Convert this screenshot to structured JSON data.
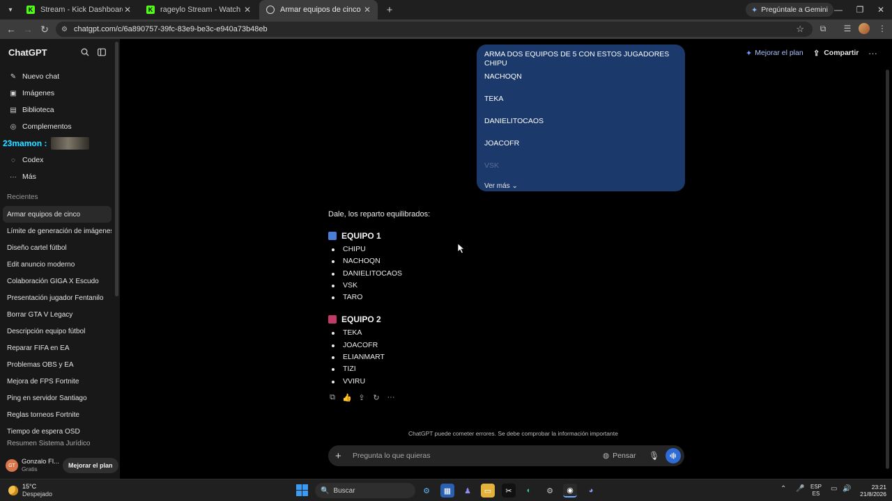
{
  "browser": {
    "tabs": [
      {
        "title": "Stream - Kick Dashboard",
        "favicon": "kick-icon",
        "active": false
      },
      {
        "title": "rageylo Stream - Watch Live on",
        "favicon": "kick-icon",
        "active": false
      },
      {
        "title": "Armar equipos de cinco",
        "favicon": "chatgpt-icon",
        "active": true
      }
    ],
    "gemini_label": "Pregúntale a Gemini",
    "url": "chatgpt.com/c/6a890757-39fc-83e9-be3c-e940a73b48eb"
  },
  "sidebar": {
    "brand": "ChatGPT",
    "nav": [
      {
        "label": "Nuevo chat",
        "icon": "edit-icon"
      },
      {
        "label": "Imágenes",
        "icon": "image-icon"
      },
      {
        "label": "Biblioteca",
        "icon": "library-icon"
      },
      {
        "label": "Complementos",
        "icon": "plugins-icon"
      },
      {
        "label": "Codex",
        "icon": "codex-icon"
      },
      {
        "label": "Más",
        "icon": "more-icon"
      }
    ],
    "overlay_text": "23mamon :",
    "recent_heading": "Recientes",
    "recent": [
      "Armar equipos de cinco",
      "Límite de generación de imágenes",
      "Diseño cartel fútbol",
      "Edit anuncio moderno",
      "Colaboración GIGA X Escudo",
      "Presentación jugador Fentanilo",
      "Borrar GTA V Legacy",
      "Descripción equipo fútbol",
      "Reparar FIFA en EA",
      "Problemas OBS y EA",
      "Mejora de FPS Fortnite",
      "Ping en servidor Santiago",
      "Reglas torneos Fortnite",
      "Tiempo de espera OSD",
      "Resumen Sistema Jurídico"
    ],
    "user": {
      "initials": "GT",
      "name": "Gonzalo Fl...",
      "plan": "Gratis",
      "upgrade_label": "Mejorar el plan"
    }
  },
  "header": {
    "upgrade_label": "Mejorar el plan",
    "share_label": "Compartir"
  },
  "conversation": {
    "user_message_lines": [
      "ARMA DOS EQUIPOS DE 5 CON ESTOS JUGADORES CHIPU",
      "NACHOQN",
      "TEKA",
      "DANIELITOCAOS",
      "JOACOFR",
      "VSK"
    ],
    "show_more_label": "Ver más",
    "assistant_intro": "Dale, los reparto equilibrados:",
    "teams": [
      {
        "name": "EQUIPO 1",
        "color": "#4a7fd9",
        "players": [
          "CHIPU",
          "NACHOQN",
          "DANIELITOCAOS",
          "VSK",
          "TARO"
        ]
      },
      {
        "name": "EQUIPO 2",
        "color": "#c23a6a",
        "players": [
          "TEKA",
          "JOACOFR",
          "ELIANMART",
          "TIZI",
          "VVIRU"
        ]
      }
    ]
  },
  "composer": {
    "disclaimer": "ChatGPT puede cometer errores. Se debe comprobar la información importante",
    "placeholder": "Pregunta lo que quieras",
    "think_label": "Pensar"
  },
  "taskbar": {
    "temperature": "15°C",
    "weather": "Despejado",
    "search_label": "Buscar",
    "lang_top": "ESP",
    "lang_bottom": "ES",
    "time": "23:21",
    "date": "21/8/2026"
  }
}
